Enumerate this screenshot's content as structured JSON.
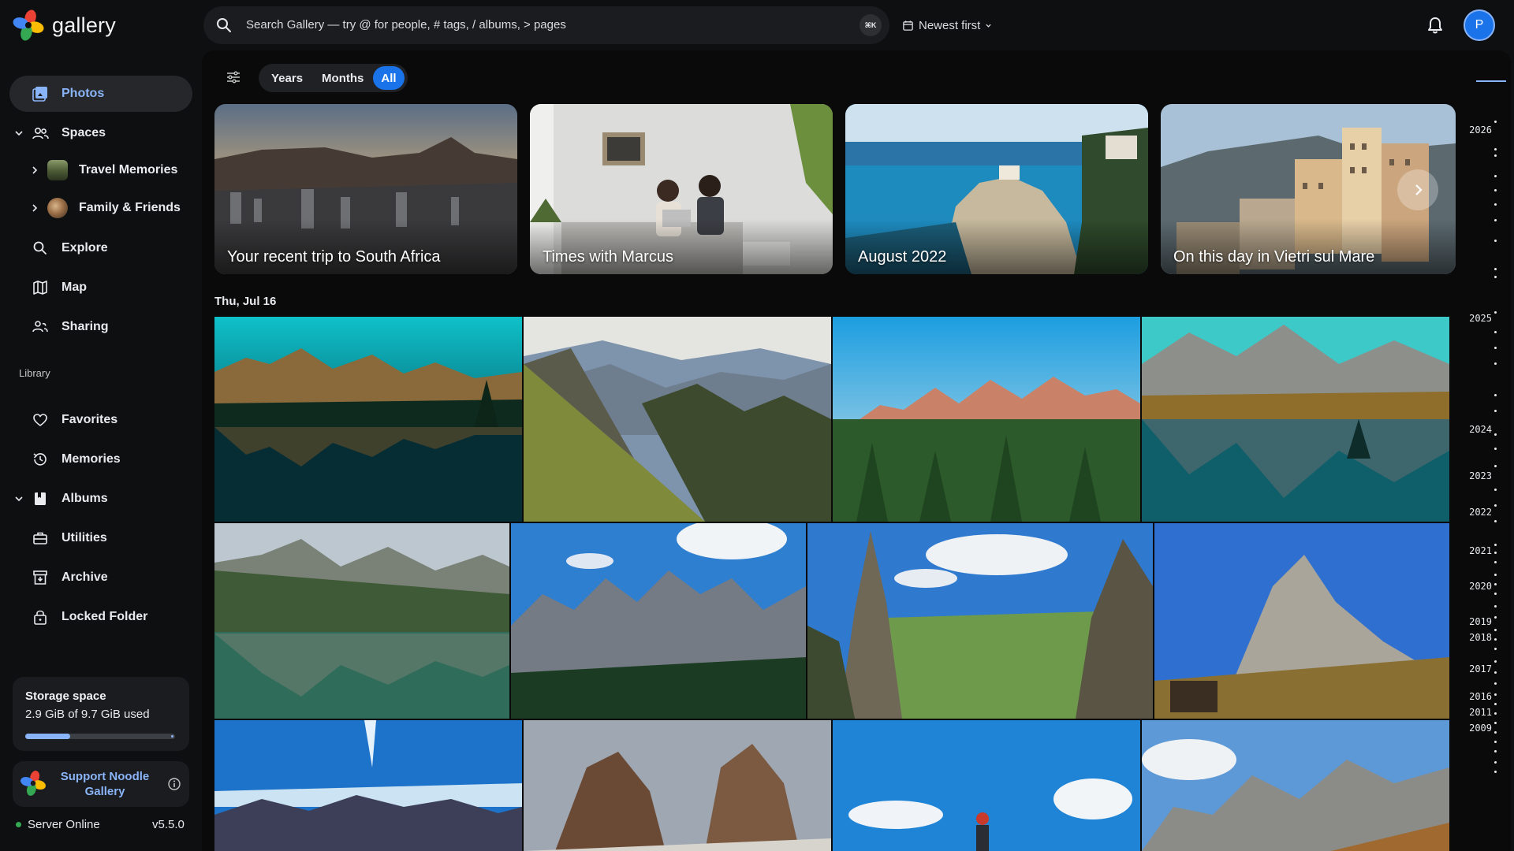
{
  "app": {
    "name": "gallery",
    "colors": {
      "accent": "#1a73e8",
      "accent_light": "#8ab4f8",
      "online": "#34a853",
      "bg": "#0e0f11"
    }
  },
  "header": {
    "search_placeholder": "Search Gallery — try @ for people, # tags, / albums, > pages",
    "shortcut": "⌘K",
    "sort_label": "Newest first",
    "avatar_initial": "P",
    "icons": [
      "search-icon",
      "calendar-icon",
      "chevron-down-icon",
      "bell-icon"
    ]
  },
  "sidebar": {
    "items": [
      {
        "label": "Photos",
        "icon": "photos-icon",
        "active": true
      },
      {
        "label": "Spaces",
        "icon": "people-icon",
        "expanded": true
      },
      {
        "label": "Travel Memories",
        "icon": "space-thumbnail"
      },
      {
        "label": "Family & Friends",
        "icon": "space-thumbnail"
      },
      {
        "label": "Explore",
        "icon": "search-icon"
      },
      {
        "label": "Map",
        "icon": "map-icon"
      },
      {
        "label": "Sharing",
        "icon": "sharing-icon"
      }
    ],
    "library_label": "Library",
    "library": [
      {
        "label": "Favorites",
        "icon": "heart-icon"
      },
      {
        "label": "Memories",
        "icon": "history-icon"
      },
      {
        "label": "Albums",
        "icon": "album-icon",
        "expanded": true
      },
      {
        "label": "Utilities",
        "icon": "toolbox-icon"
      },
      {
        "label": "Archive",
        "icon": "archive-icon"
      },
      {
        "label": "Locked Folder",
        "icon": "lock-icon"
      }
    ],
    "storage": {
      "title": "Storage space",
      "usage": "2.9 GiB of 9.7 GiB used",
      "used_fraction": 0.3
    },
    "support_label": "Support Noodle Gallery",
    "server_status": "Server Online",
    "version": "v5.5.0"
  },
  "toolbar": {
    "views": [
      "Years",
      "Months",
      "All"
    ],
    "selected_view": "All"
  },
  "memories": [
    {
      "caption": "Your recent trip to South Africa"
    },
    {
      "caption": "Times with Marcus"
    },
    {
      "caption": "August 2022"
    },
    {
      "caption": "On this day in Vietri sul Mare"
    }
  ],
  "timeline": {
    "date_header": "Thu, Jul 16",
    "photo_count_visible": 12
  },
  "scrubber": {
    "years": [
      "2026",
      "2025",
      "2024",
      "2023",
      "2022",
      "2021",
      "2020",
      "2019",
      "2018",
      "2017",
      "2016",
      "2011",
      "2009"
    ]
  }
}
